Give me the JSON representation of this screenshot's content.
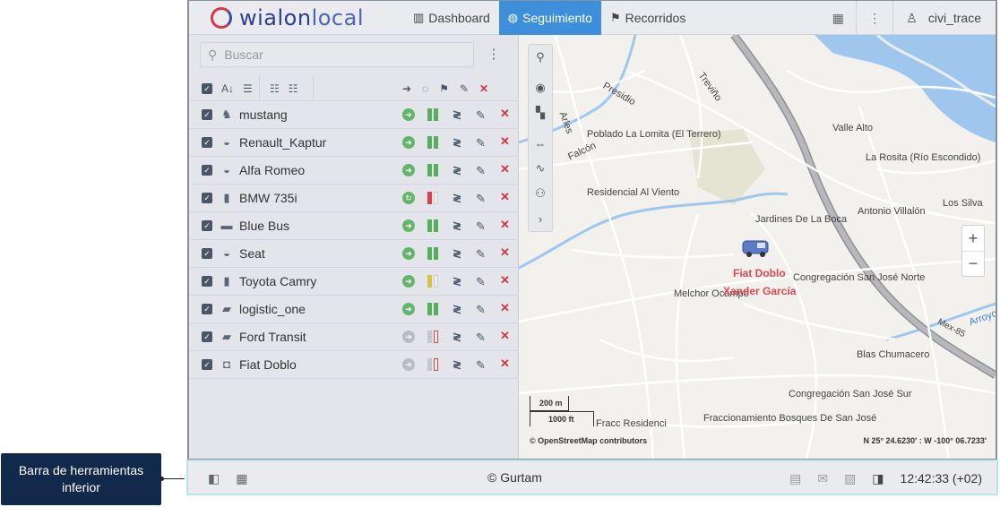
{
  "callout": {
    "text": "Barra de herramientas inferior"
  },
  "header": {
    "logo_text_a": "wialon",
    "logo_text_b": "local",
    "nav": [
      {
        "label": "Dashboard",
        "icon": "bar-chart-icon",
        "active": false
      },
      {
        "label": "Seguimiento",
        "icon": "globe-icon",
        "active": true
      },
      {
        "label": "Recorridos",
        "icon": "checkered-flag-icon",
        "active": false
      }
    ],
    "user": "civi_trace"
  },
  "panel": {
    "search_placeholder": "Buscar",
    "units": [
      {
        "name": "mustang",
        "icon": "horse-icon",
        "conn": "online",
        "bars": "full"
      },
      {
        "name": "Renault_Kaptur",
        "icon": "car-icon",
        "conn": "online",
        "bars": "full"
      },
      {
        "name": "Alfa Romeo",
        "icon": "car-icon",
        "conn": "online",
        "bars": "full"
      },
      {
        "name": "BMW 735i",
        "icon": "phone-icon",
        "conn": "moving",
        "bars": "bmw"
      },
      {
        "name": "Blue Bus",
        "icon": "bus-icon",
        "conn": "online",
        "bars": "full"
      },
      {
        "name": "Seat",
        "icon": "car-icon",
        "conn": "online",
        "bars": "full"
      },
      {
        "name": "Toyota Camry",
        "icon": "phone-icon",
        "conn": "online",
        "bars": "toy"
      },
      {
        "name": "logistic_one",
        "icon": "truck-icon",
        "conn": "online",
        "bars": "full"
      },
      {
        "name": "Ford Transit",
        "icon": "truck-icon",
        "conn": "offline",
        "bars": "off"
      },
      {
        "name": "Fiat Doblo",
        "icon": "van-icon",
        "conn": "offline",
        "bars": "off"
      }
    ]
  },
  "map": {
    "labels": [
      {
        "text": "Presidio"
      },
      {
        "text": "Treviño"
      },
      {
        "text": "Arles"
      },
      {
        "text": "Poblado La Lomita (El Terrero)"
      },
      {
        "text": "Falcón"
      },
      {
        "text": "Valle Alto"
      },
      {
        "text": "La Rosita (Río Escondido)"
      },
      {
        "text": "Residencial Al Viento"
      },
      {
        "text": "Jardines De La Boca"
      },
      {
        "text": "Antonio Villalón"
      },
      {
        "text": "Los Silva"
      },
      {
        "text": "Congregación San José Norte"
      },
      {
        "text": "Melchor Ocampo"
      },
      {
        "text": "Mex-85"
      },
      {
        "text": "Blas Chumacero"
      },
      {
        "text": "Congregación San José Sur"
      },
      {
        "text": "Fracc Residenci"
      },
      {
        "text": "Fraccionamiento Bosques De San José"
      },
      {
        "text": "Arroyo"
      }
    ],
    "unit_name": "Fiat Doblo",
    "driver_name": "Xander García",
    "scale_m": "200 m",
    "scale_ft": "1000 ft",
    "attribution": "© OpenStreetMap contributors",
    "coords": "N 25° 24.6230' : W -100° 06.7233'"
  },
  "bottombar": {
    "copyright": "© Gurtam",
    "time": "12:42:33 (+02)"
  }
}
